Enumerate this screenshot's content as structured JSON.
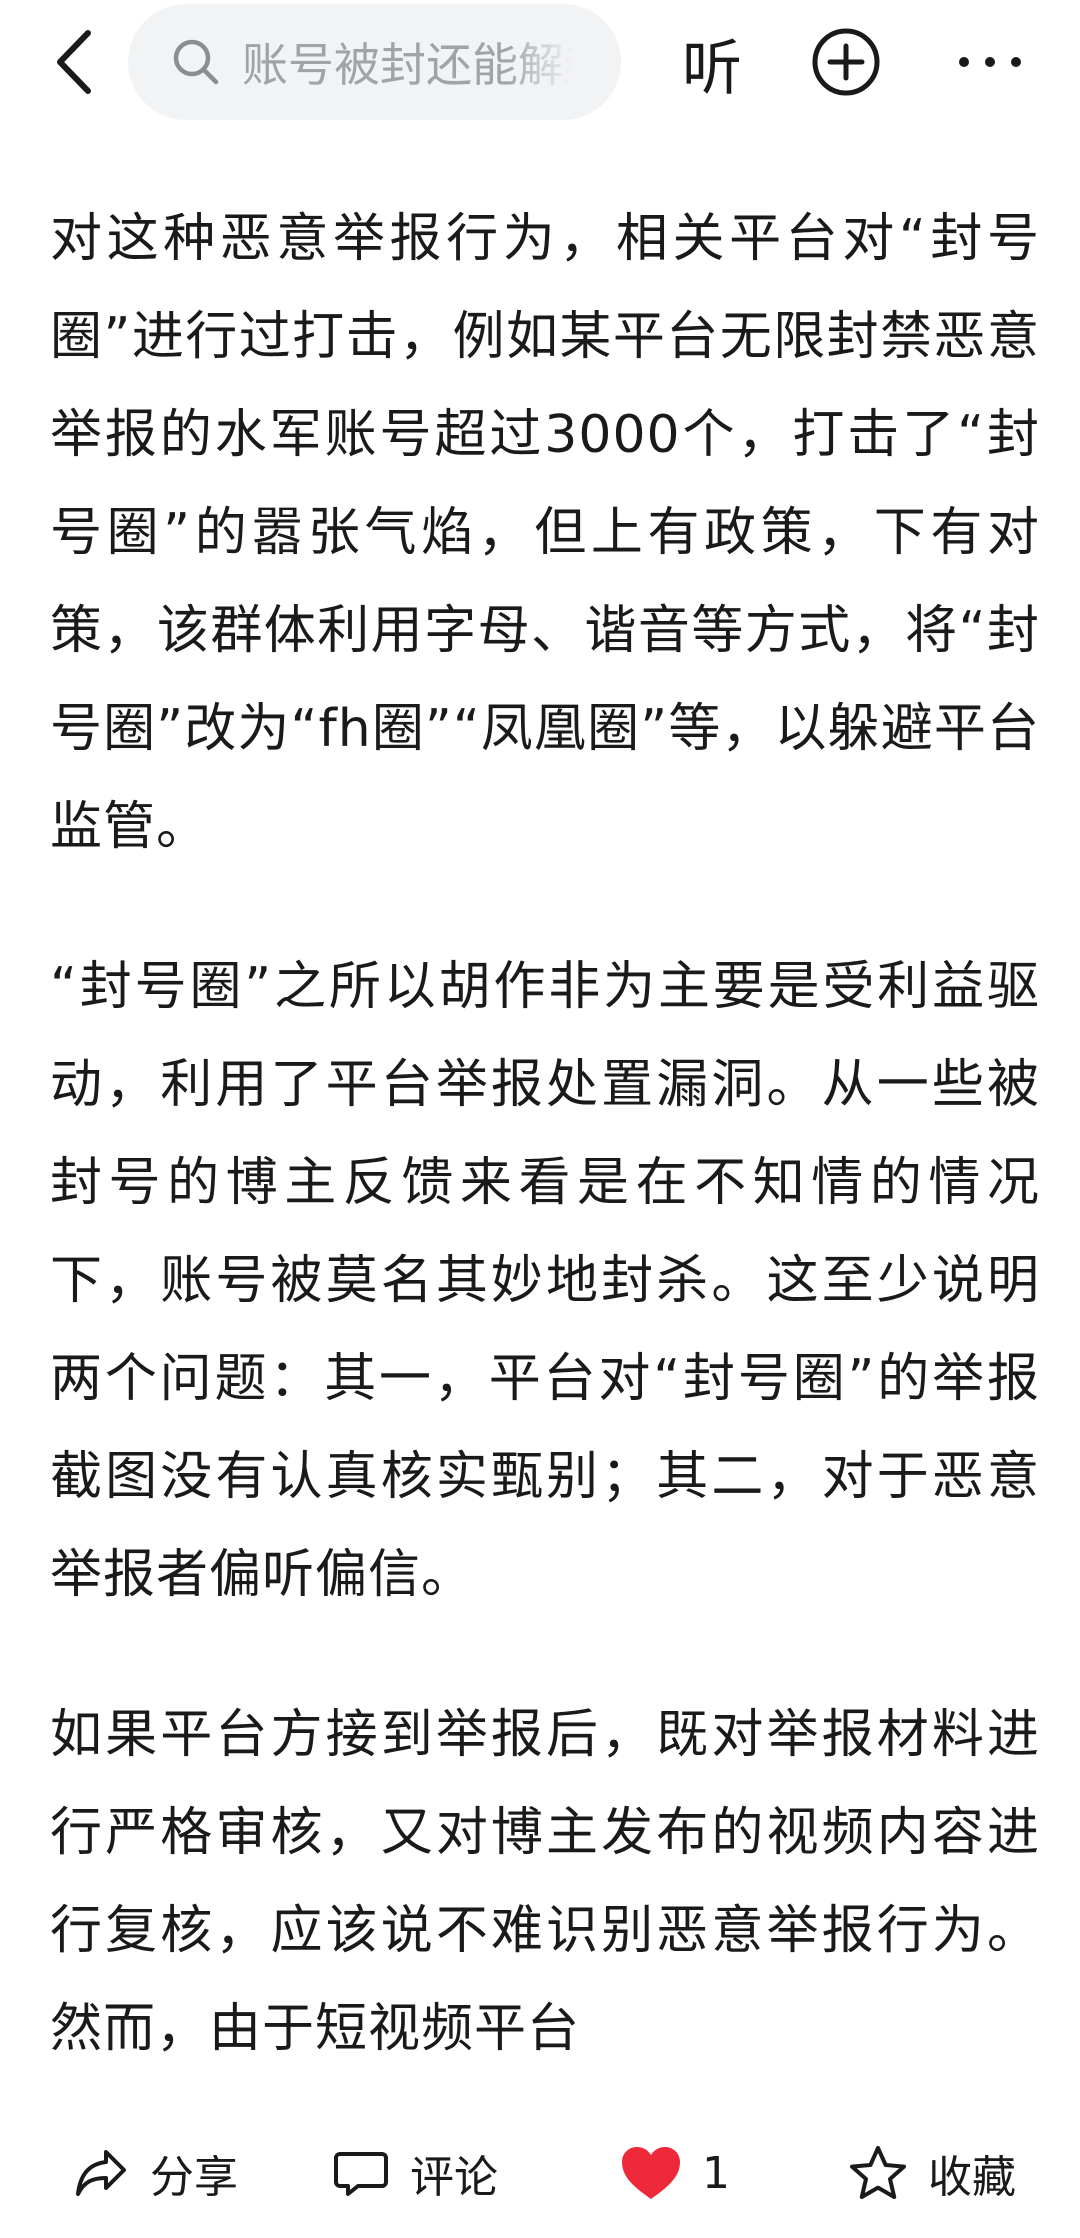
{
  "header": {
    "search_placeholder": "账号被封还能解封吗",
    "listen_label": "听"
  },
  "article": {
    "paragraphs": [
      "对这种恶意举报行为，相关平台对“封号圈”进行过打击，例如某平台无限封禁恶意举报的水军账号超过3000个，打击了“封号圈”的嚣张气焰，但上有政策，下有对策，该群体利用字母、谐音等方式，将“封号圈”改为“fh圈”“凤凰圈”等，以躲避平台监管。",
      "“封号圈”之所以胡作非为主要是受利益驱动，利用了平台举报处置漏洞。从一些被封号的博主反馈来看是在不知情的情况下，账号被莫名其妙地封杀。这至少说明两个问题：其一，平台对“封号圈”的举报截图没有认真核实甄别；其二，对于恶意举报者偏听偏信。",
      "如果平台方接到举报后，既对举报材料进行严格审核，又对博主发布的视频内容进行复核，应该说不难识别恶意举报行为。然而，由于短视频平台"
    ]
  },
  "actions": {
    "share_label": "分享",
    "comment_label": "评论",
    "like_count": "1",
    "favorite_label": "收藏"
  },
  "colors": {
    "like_heart": "#ee2a3a",
    "search_bg": "#f2f3f5",
    "text": "#1a1a1a",
    "placeholder": "#a0a3a8"
  },
  "icons": [
    "back-arrow-icon",
    "search-icon",
    "plus-circle-icon",
    "more-dots-icon",
    "share-icon",
    "comment-icon",
    "heart-icon",
    "star-icon"
  ]
}
